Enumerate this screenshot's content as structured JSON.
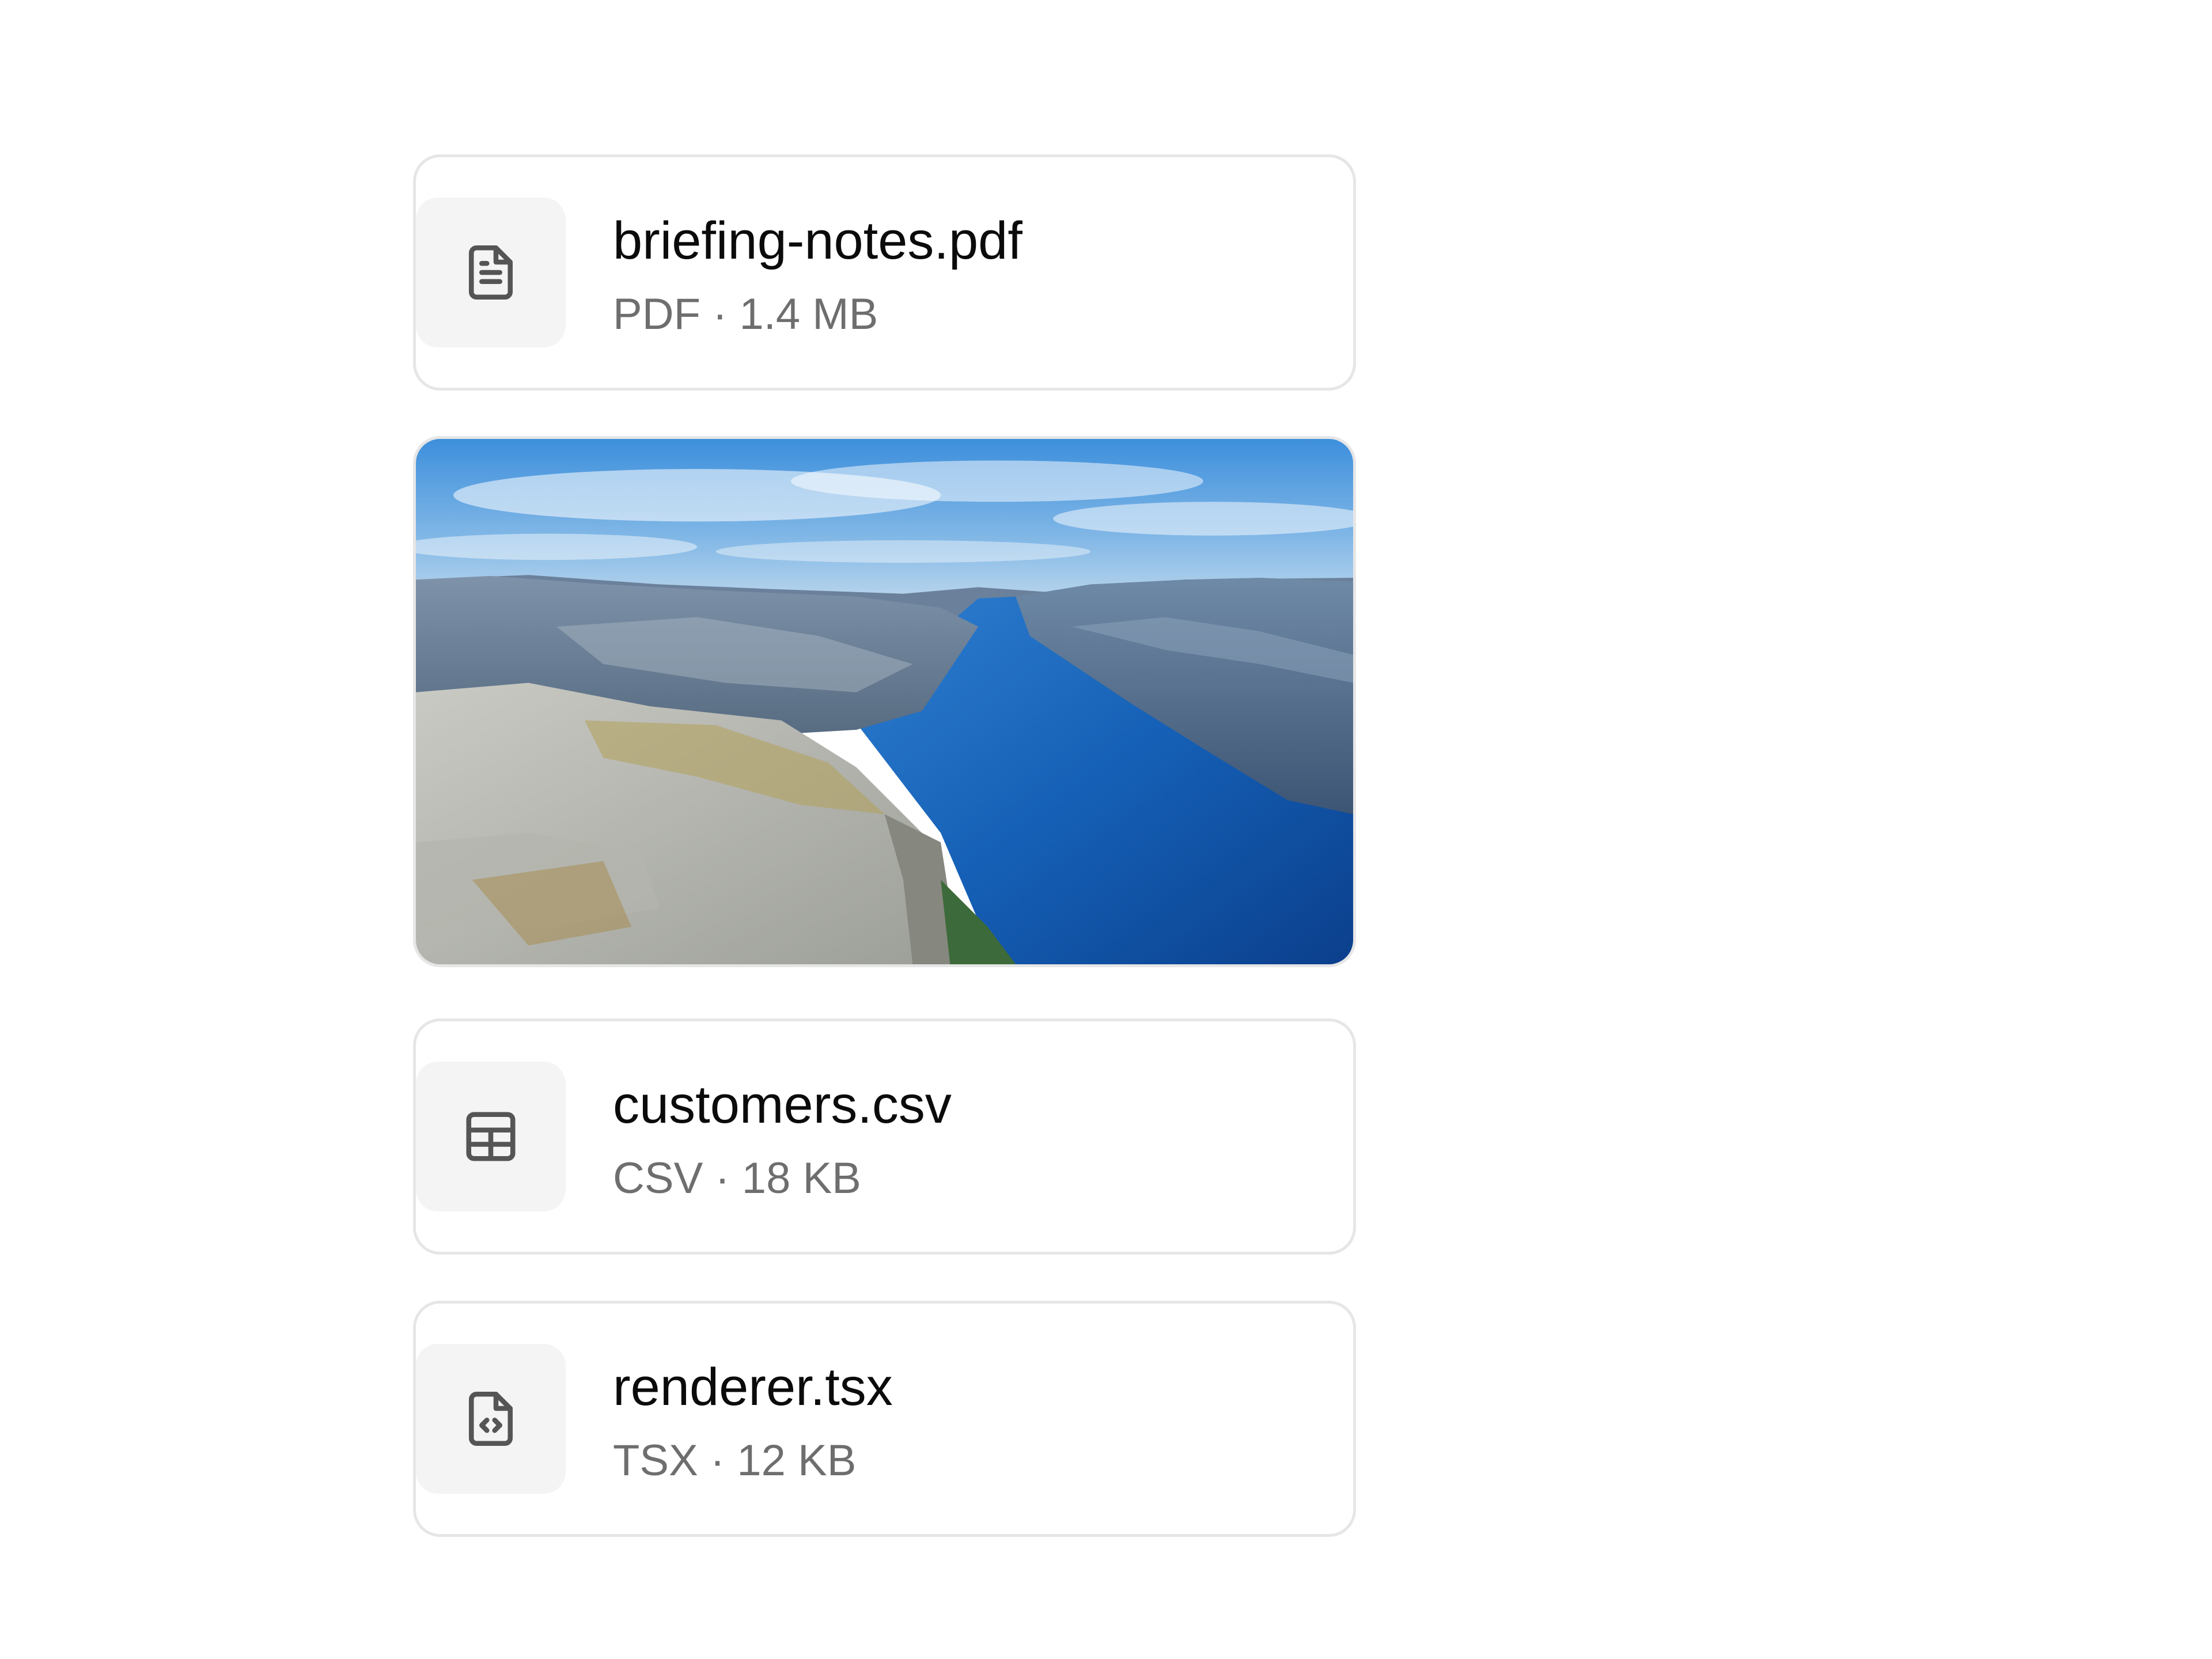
{
  "attachments": [
    {
      "kind": "file",
      "name": "briefing-notes.pdf",
      "meta": "PDF · 1.4 MB",
      "icon": "document-icon"
    },
    {
      "kind": "image",
      "alt": ""
    },
    {
      "kind": "file",
      "name": "customers.csv",
      "meta": "CSV · 18 KB",
      "icon": "table-icon"
    },
    {
      "kind": "file",
      "name": "renderer.tsx",
      "meta": "TSX · 12 KB",
      "icon": "code-file-icon"
    }
  ],
  "colors": {
    "card_border": "#e6e6e6",
    "icon_background": "#f4f4f4",
    "icon_stroke": "#555555",
    "name_text": "#0b0b0b",
    "meta_text": "#6e6e6e"
  }
}
